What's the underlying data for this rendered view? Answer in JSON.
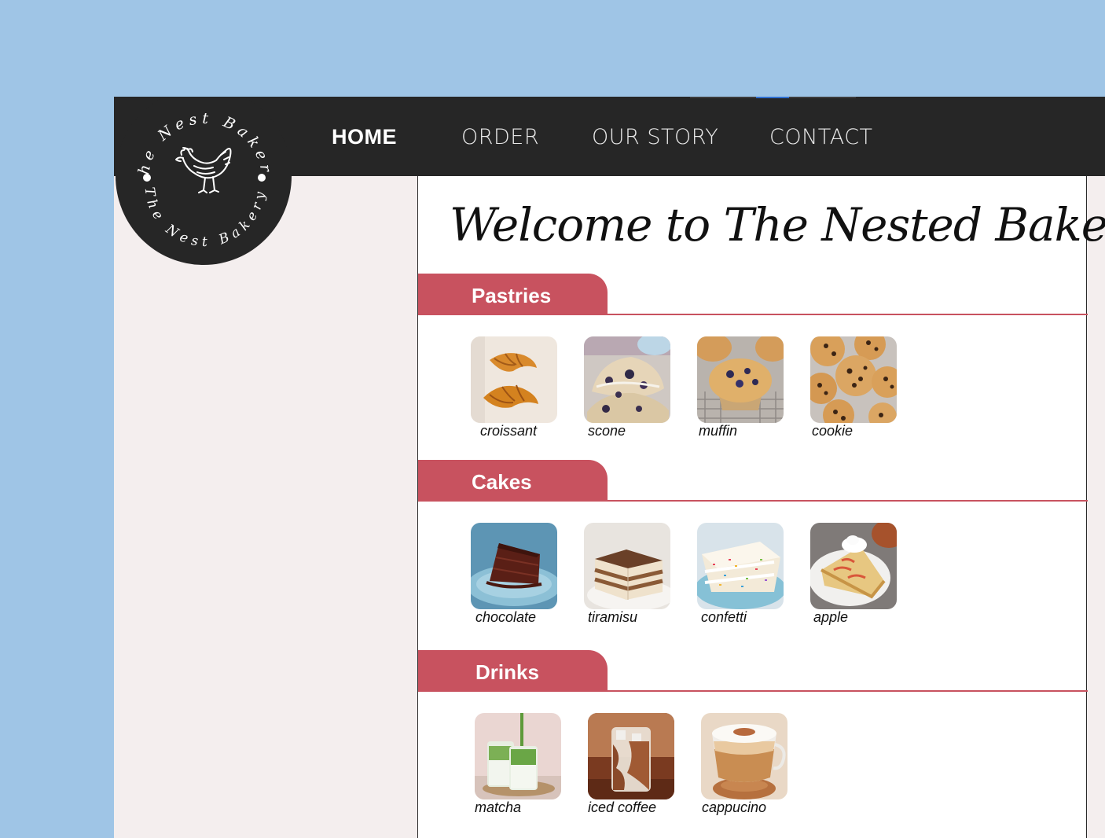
{
  "logo": {
    "ring_text": "The Nest Bakery",
    "icon": "hen-icon"
  },
  "nav": {
    "items": [
      {
        "label": "HOME",
        "active": true
      },
      {
        "label": "ORDER",
        "active": false
      },
      {
        "label": "OUR STORY",
        "active": false
      },
      {
        "label": "CONTACT",
        "active": false
      }
    ]
  },
  "main": {
    "welcome": "Welcome to The Nested Bakery",
    "sections": [
      {
        "title": "Pastries",
        "items": [
          {
            "label": "croissant",
            "icon": "croissant-image"
          },
          {
            "label": "scone",
            "icon": "scone-image"
          },
          {
            "label": "muffin",
            "icon": "muffin-image"
          },
          {
            "label": "cookie",
            "icon": "cookie-image"
          }
        ]
      },
      {
        "title": "Cakes",
        "items": [
          {
            "label": "chocolate",
            "icon": "chocolate-cake-image"
          },
          {
            "label": "tiramisu",
            "icon": "tiramisu-image"
          },
          {
            "label": "confetti",
            "icon": "confetti-cake-image"
          },
          {
            "label": "apple",
            "icon": "apple-cake-image"
          }
        ]
      },
      {
        "title": "Drinks",
        "items": [
          {
            "label": "matcha",
            "icon": "matcha-image"
          },
          {
            "label": "iced coffee",
            "icon": "iced-coffee-image"
          },
          {
            "label": "cappucino",
            "icon": "cappucino-image"
          }
        ]
      }
    ]
  },
  "colors": {
    "background": "#9fc5e6",
    "navbar": "#262626",
    "accent": "#c8525f",
    "page": "#f4eeee"
  }
}
